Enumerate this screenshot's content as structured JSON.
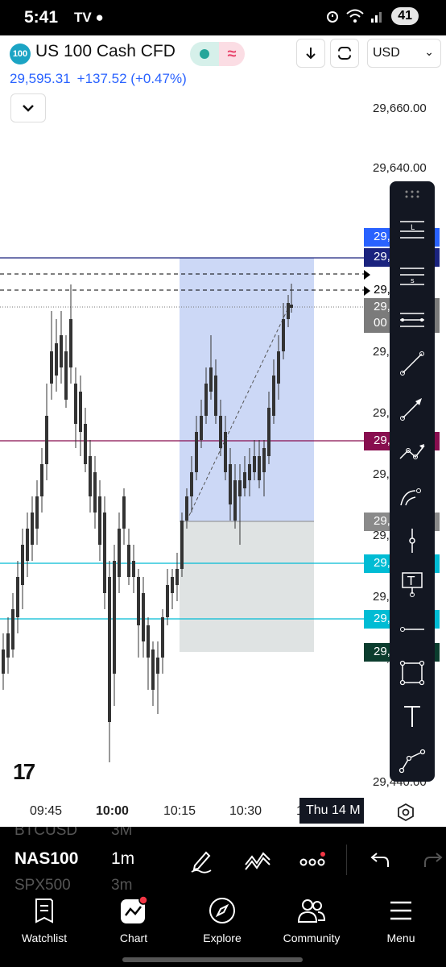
{
  "status_bar": {
    "time": "5:41",
    "left_icons": "TV ●",
    "battery": "41"
  },
  "header": {
    "symbol_badge": "100",
    "symbol_title": "US 100 Cash CFD",
    "market_status_icon": "≈",
    "currency": "USD",
    "last_price": "29,595.31",
    "change": "+137.52 (+0.47%)"
  },
  "chart": {
    "price_labels": [
      "29,660.00",
      "29,640.00",
      "29,",
      "29,",
      "29,",
      "29,",
      "29,",
      "29,",
      "29,440.00"
    ],
    "axis_tags": [
      {
        "text": "29,",
        "color": "#2962ff"
      },
      {
        "text": "29,",
        "color": "#1a237e"
      },
      {
        "text": "29,",
        "color": "#000000"
      },
      {
        "text": "29,",
        "color": "#7b7b7b"
      },
      {
        "text": "00",
        "color": "#7b7b7b"
      },
      {
        "text": "29,",
        "color": "#880e4f"
      },
      {
        "text": "29,",
        "color": "#8a8a8a"
      },
      {
        "text": "29,",
        "color": "#00bcd4"
      },
      {
        "text": "29,",
        "color": "#00bcd4"
      },
      {
        "text": "29,",
        "color": "#0b3d2e"
      }
    ],
    "time_labels": [
      "09:45",
      "10:00",
      "10:15",
      "10:30",
      "1"
    ],
    "crosshair_date": "Thu 14 M"
  },
  "drawing_tools": [
    "long-position-icon",
    "short-position-icon",
    "parallel-lines-icon",
    "trend-line-icon",
    "arrow-line-icon",
    "path-icon",
    "curve-icon",
    "vertical-line-icon",
    "text-callout-icon",
    "horizontal-ray-icon",
    "rectangle-icon",
    "text-icon",
    "polyline-icon"
  ],
  "bottom_toolbar": {
    "symbols": [
      "BTCUSD",
      "NAS100",
      "SPX500"
    ],
    "intervals": [
      "3M",
      "1m",
      "3m"
    ]
  },
  "bottom_nav": {
    "watchlist": "Watchlist",
    "chart": "Chart",
    "explore": "Explore",
    "community": "Community",
    "menu": "Menu"
  }
}
